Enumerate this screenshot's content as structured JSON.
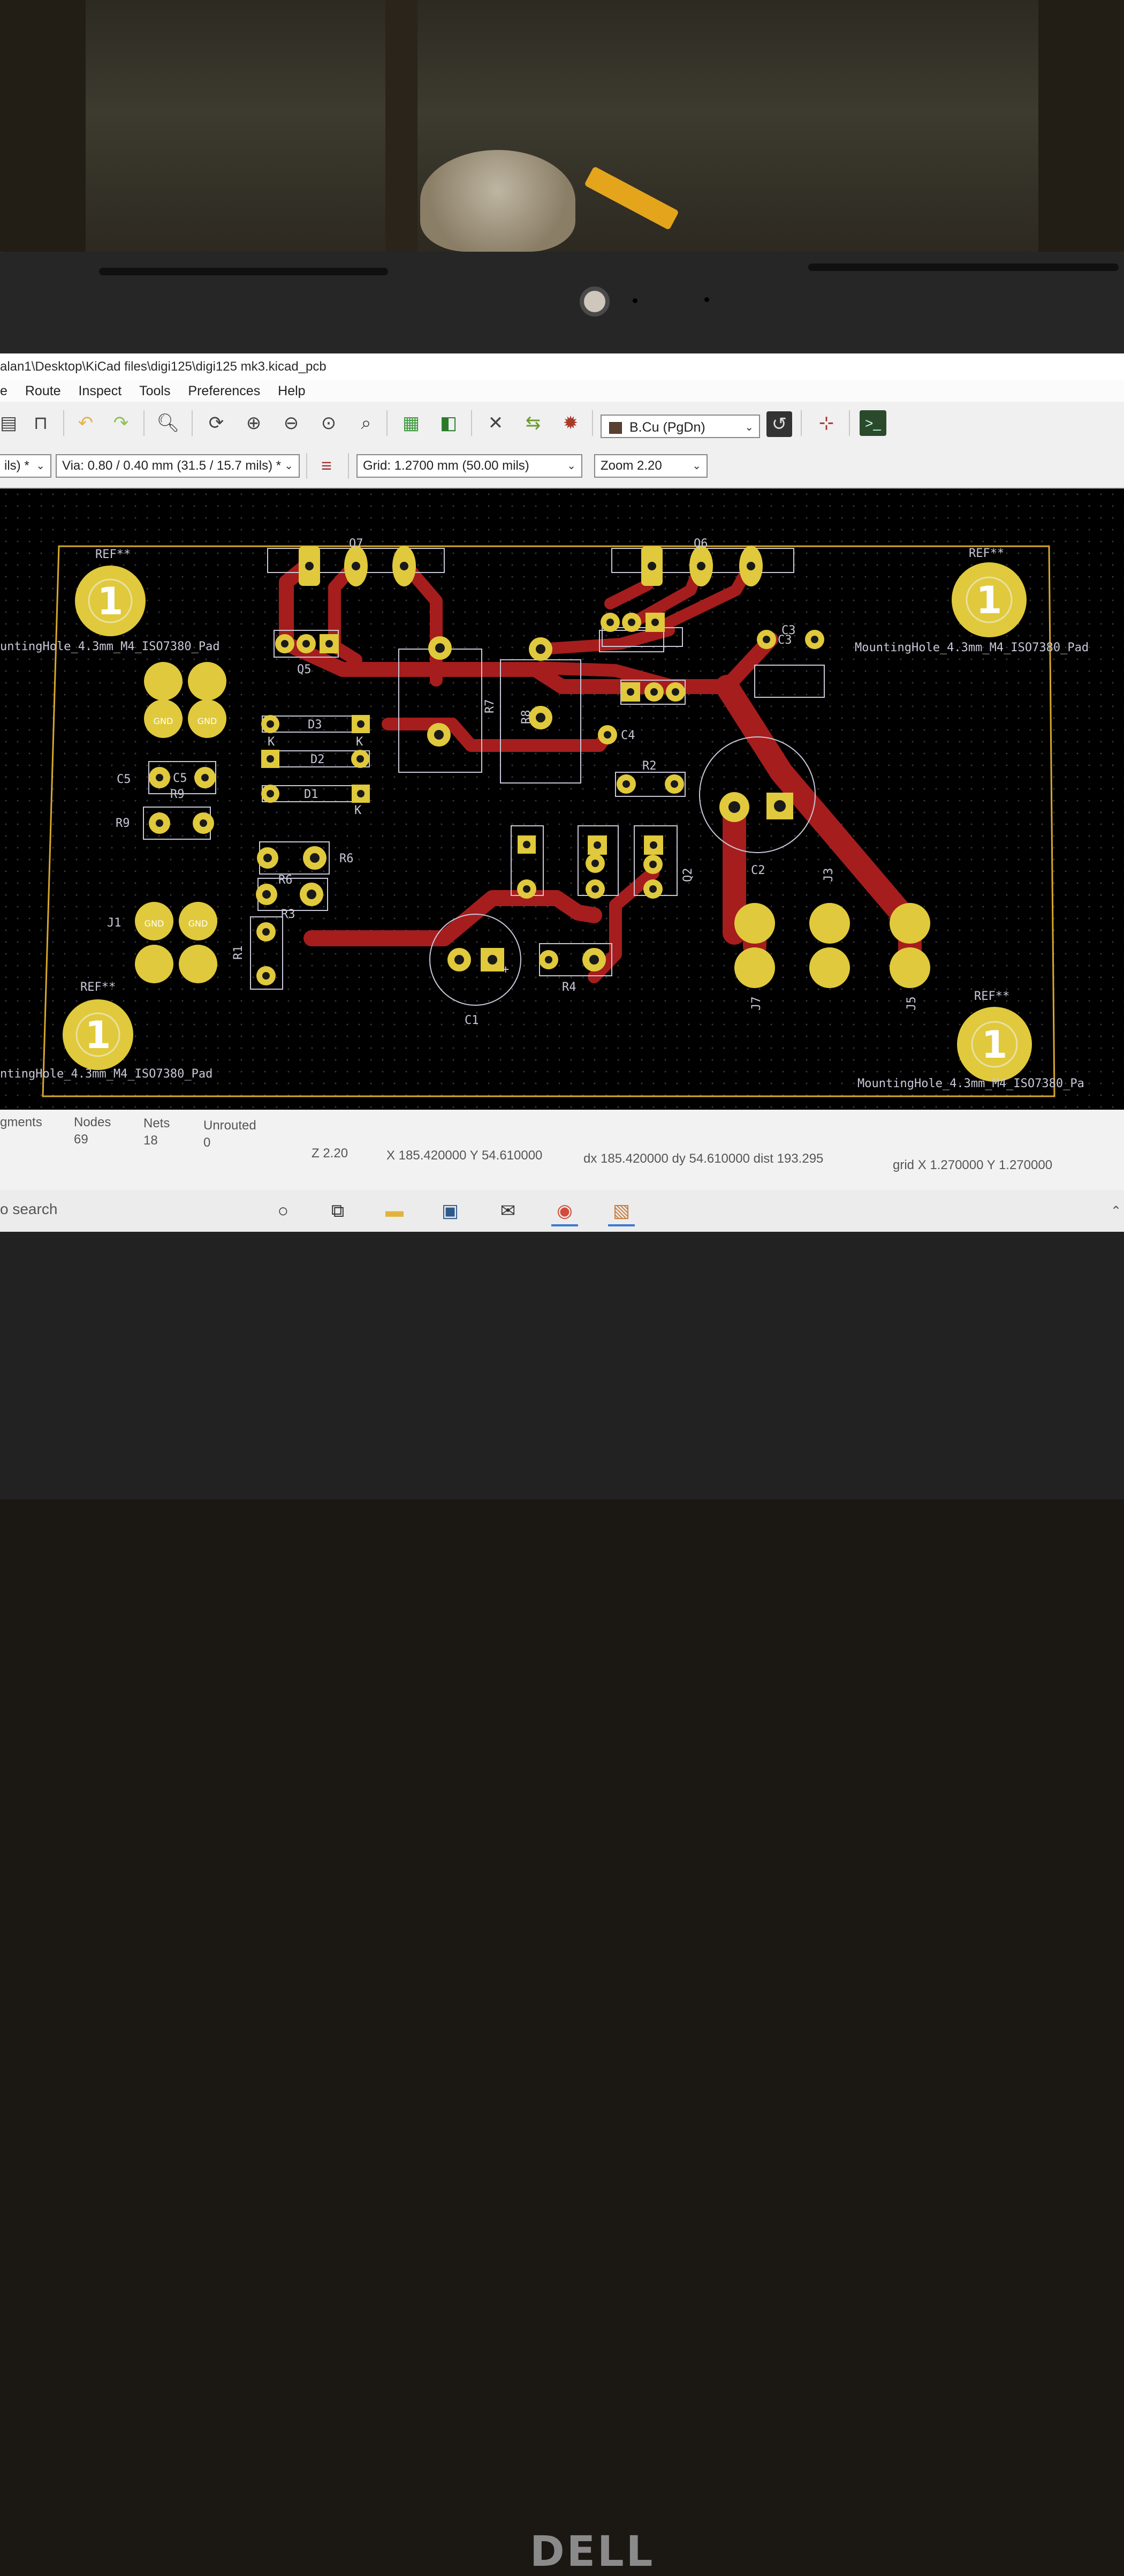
{
  "window": {
    "title": "alan1\\Desktop\\KiCad files\\digi125\\digi125 mk3.kicad_pcb"
  },
  "menu": [
    "e",
    "Route",
    "Inspect",
    "Tools",
    "Preferences",
    "Help"
  ],
  "toolbar": {
    "layer": "B.Cu (PgDn)",
    "layer_color": "#5a4030",
    "track_width": "ils) *",
    "via": "Via: 0.80 / 0.40 mm (31.5 / 15.7 mils) *",
    "grid": "Grid: 1.2700 mm (50.00 mils)",
    "zoom": "Zoom 2.20",
    "icons": [
      "print-icon",
      "plot-icon",
      "undo-icon",
      "redo-icon",
      "find-icon",
      "refresh-icon",
      "zoom-in-icon",
      "zoom-out-icon",
      "zoom-fit-icon",
      "zoom-area-icon",
      "footprint-editor-icon",
      "footprint-browser-icon",
      "netlist-icon",
      "update-pcb-icon",
      "drc-icon",
      "layer-pair-icon",
      "microwave-icon",
      "scripting-console-icon"
    ]
  },
  "pcb": {
    "copper_color": "#a61d1d",
    "pad_color": "#e0c93c",
    "outline_color": "#d6a82b",
    "silk_color": "#c8c8d8",
    "labels": {
      "ref_tl": "REF**",
      "ref_tr": "REF**",
      "ref_bl": "REF**",
      "ref_br": "REF**",
      "mh_tl": "untingHole_4.3mm_M4_ISO7380_Pad",
      "mh_tr": "MountingHole_4.3mm_M4_ISO7380_Pad",
      "mh_bl": "ntingHole_4.3mm_M4_ISO7380_Pad",
      "mh_br": "MountingHole_4.3mm_M4_ISO7380_Pa",
      "q7": "Q7",
      "q6": "Q6",
      "q5": "Q5",
      "q2": "Q2",
      "d3": "D3",
      "d2": "D2",
      "d1": "D1",
      "c5": "C5",
      "c5b": "C5",
      "c3": "C3",
      "c3b": "C3",
      "c4": "C4",
      "c2": "C2",
      "c1": "C1",
      "r9": "R9",
      "r9b": "R9",
      "r6": "R6",
      "r6b": "R6",
      "r3": "R3",
      "r4": "R4",
      "r1": "R1",
      "r2": "R2",
      "r7": "R7",
      "r8": "R8",
      "j1": "J1",
      "j7": "J7",
      "j5": "J5",
      "j3": "J3",
      "k1": "K",
      "k2": "K",
      "k3": "K",
      "gnd1": "GND",
      "gnd2": "GND",
      "gnd3": "GND",
      "gnd4": "GND",
      "mh_num": "1",
      "plus": "+"
    }
  },
  "status": {
    "segments_label": "gments",
    "nodes_label": "Nodes",
    "nodes_value": "69",
    "nets_label": "Nets",
    "nets_value": "18",
    "unrouted_label": "Unrouted",
    "unrouted_value": "0",
    "zoom": "Z 2.20",
    "coords": "X 185.420000  Y 54.610000",
    "delta": "dx 185.420000  dy 54.610000  dist 193.295",
    "grid": "grid X 1.270000  Y 1.270000"
  },
  "taskbar": {
    "search": "o search",
    "icons": [
      "cortana-icon",
      "task-view-icon",
      "file-explorer-icon",
      "store-icon",
      "mail-icon",
      "chrome-icon",
      "kicad-pcbnew-icon"
    ]
  },
  "brand": "DELL"
}
